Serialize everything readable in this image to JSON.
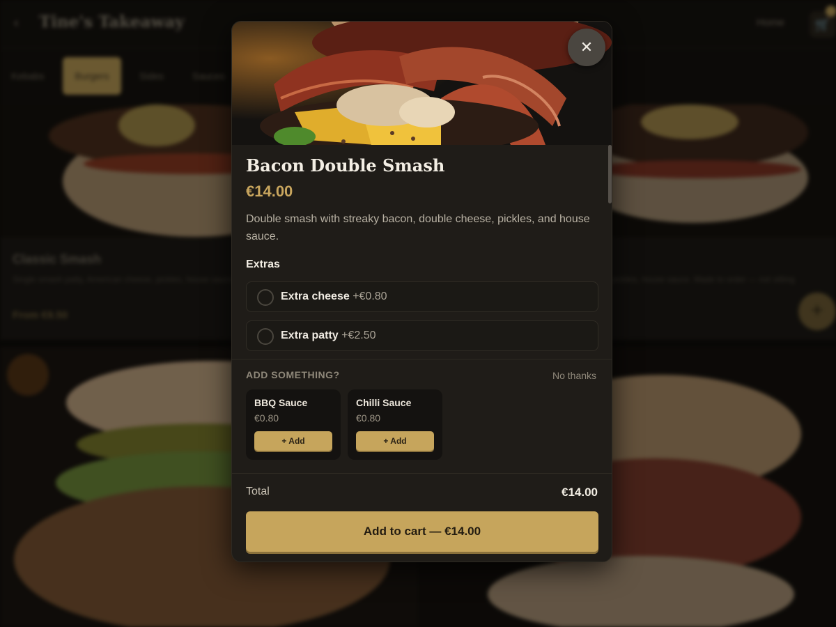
{
  "background": {
    "header": {
      "back_icon": "back-arrow-icon",
      "brand": "Tine's Takeaway",
      "home_link": "Home",
      "cart_icon": "cart-icon"
    },
    "tabs": [
      {
        "label": "Kebabs",
        "active": false
      },
      {
        "label": "Burgers",
        "active": true
      },
      {
        "label": "Sides",
        "active": false
      },
      {
        "label": "Sauces",
        "active": false
      }
    ],
    "card": {
      "title": "Classic Smash",
      "description": "Single smash patty, American cheese, pickles, house sauce.",
      "description_right": "pickles, house sauce. Made to order — not sitting",
      "price": "From €9.50"
    }
  },
  "modal": {
    "close_icon": "close-icon",
    "item_title": "Bacon Double Smash",
    "item_price": "€14.00",
    "description": "Double smash with streaky bacon, double cheese, pickles, and house sauce.",
    "extras_heading": "Extras",
    "extras": [
      {
        "label": "Extra cheese",
        "price": "+€0.80",
        "selected": false
      },
      {
        "label": "Extra patty",
        "price": "+€2.50",
        "selected": false
      }
    ],
    "upsell": {
      "heading": "ADD SOMETHING?",
      "dismiss": "No thanks",
      "items": [
        {
          "name": "BBQ Sauce",
          "price": "€0.80",
          "button": "+ Add"
        },
        {
          "name": "Chilli Sauce",
          "price": "€0.80",
          "button": "+ Add"
        }
      ]
    },
    "total_label": "Total",
    "total_value": "€14.00",
    "cta": "Add to cart — €14.00"
  },
  "colors": {
    "accent": "#c6a55c",
    "modal_bg": "#1f1c18",
    "page_bg": "#0f0d0a"
  }
}
